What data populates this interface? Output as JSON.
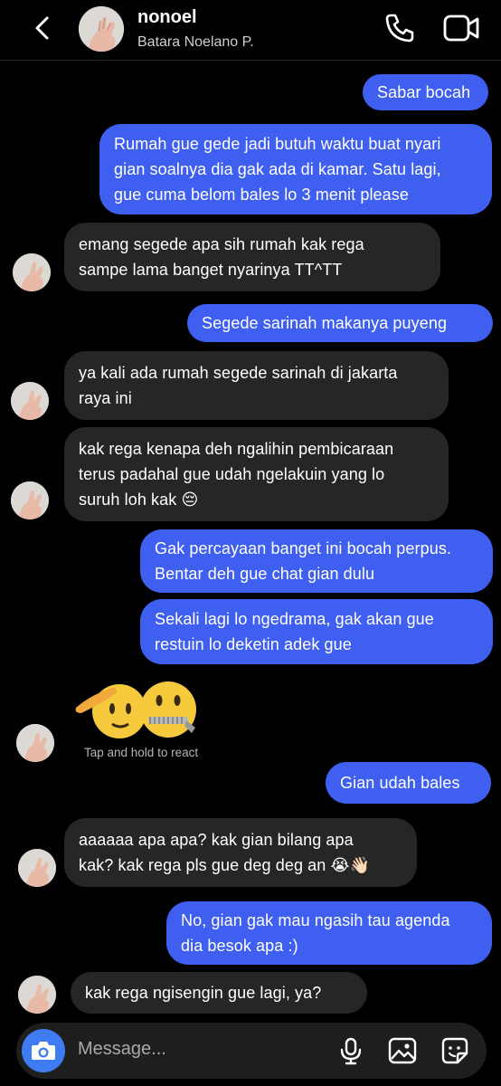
{
  "header": {
    "name": "nonoel",
    "subtitle": "Batara Noelano P."
  },
  "messages": [
    {
      "dir": "sent",
      "text": "Sabar bocah"
    },
    {
      "dir": "sent",
      "text": "Rumah gue gede jadi butuh waktu buat nyari\ngian soalnya dia gak ada di kamar. Satu lagi,\ngue cuma belom bales lo 3 menit please"
    },
    {
      "dir": "recv",
      "text": "emang segede apa sih rumah kak rega\nsampe lama banget nyarinya TT^TT"
    },
    {
      "dir": "sent",
      "text": "Segede sarinah makanya puyeng"
    },
    {
      "dir": "recv",
      "text": "ya kali ada rumah segede sarinah di jakarta\nraya ini"
    },
    {
      "dir": "recv",
      "text": "kak rega kenapa deh ngalihin pembicaraan\nterus padahal gue udah ngelakuin yang lo\nsuruh loh kak 😔"
    },
    {
      "dir": "sent",
      "text": "Gak percayaan banget ini bocah perpus.\nBentar deh gue chat gian dulu"
    },
    {
      "dir": "sent",
      "text": "Sekali lagi lo ngedrama, gak akan gue\nrestuin lo deketin adek gue"
    },
    {
      "dir": "sent",
      "text": "Gian udah bales"
    },
    {
      "dir": "recv",
      "text": "aaaaaa apa apa? kak gian bilang apa\nkak? kak rega pls gue deg deg an 😭👋🏻"
    },
    {
      "dir": "sent",
      "text": "No, gian gak mau ngasih tau agenda\ndia besok apa :)"
    },
    {
      "dir": "recv",
      "text": "kak rega ngisengin gue lagi, ya?"
    }
  ],
  "emoji_message": {
    "emojis": [
      "saluting-face",
      "zipper-mouth-face"
    ],
    "hint": "Tap and hold to react"
  },
  "composer": {
    "placeholder": "Message..."
  },
  "icons": {
    "header": [
      "back-icon",
      "phone-icon",
      "video-call-icon"
    ],
    "composer": [
      "camera-icon",
      "microphone-icon",
      "gallery-icon",
      "sticker-icon"
    ]
  },
  "colors": {
    "background": "#000000",
    "sent_bubble": "#3f5ff0",
    "received_bubble": "#262626",
    "camera_button": "#3f7cf2"
  }
}
